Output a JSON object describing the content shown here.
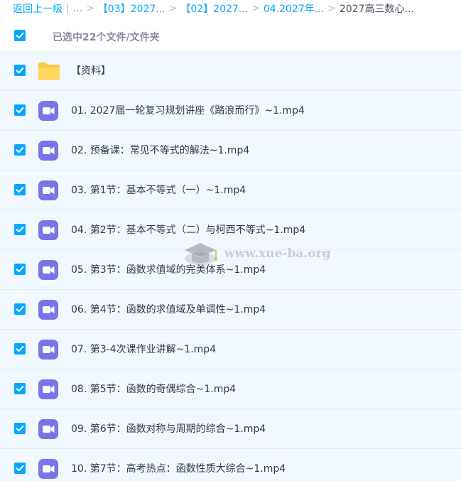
{
  "breadcrumb": {
    "back_label": "返回上一级",
    "divider": "|",
    "ellipsis": "...",
    "items": [
      {
        "label": "【03】2027..."
      },
      {
        "label": "【02】2027..."
      },
      {
        "label": "04.2027年..."
      }
    ],
    "current": "2027高三数心..."
  },
  "selection": {
    "label": "已选中22个文件/文件夹",
    "checked": true
  },
  "files": [
    {
      "name": "【资料】",
      "type": "folder",
      "checked": true
    },
    {
      "name": "01. 2027届一轮复习规划讲座《踏浪而行》~1.mp4",
      "type": "video",
      "checked": true
    },
    {
      "name": "02. 预备课：常见不等式的解法~1.mp4",
      "type": "video",
      "checked": true
    },
    {
      "name": "03. 第1节：基本不等式（一）~1.mp4",
      "type": "video",
      "checked": true
    },
    {
      "name": "04. 第2节：基本不等式（二）与柯西不等式~1.mp4",
      "type": "video",
      "checked": true
    },
    {
      "name": "05. 第3节：函数求值域的完美体系~1.mp4",
      "type": "video",
      "checked": true
    },
    {
      "name": "06. 第4节：函数的求值域及单调性~1.mp4",
      "type": "video",
      "checked": true
    },
    {
      "name": "07. 第3-4次课作业讲解~1.mp4",
      "type": "video",
      "checked": true
    },
    {
      "name": "08. 第5节：函数的奇偶综合~1.mp4",
      "type": "video",
      "checked": true
    },
    {
      "name": "09. 第6节：函数对称与周期的综合~1.mp4",
      "type": "video",
      "checked": true
    },
    {
      "name": "10. 第7节：高考热点：函数性质大综合~1.mp4",
      "type": "video",
      "checked": true
    }
  ],
  "watermark": {
    "text": "www.xue-ba.org"
  },
  "icons": {
    "folder": "folder-icon",
    "video": "video-file-icon",
    "checkbox": "checkbox-checked-icon"
  },
  "colors": {
    "accent": "#06a7ff",
    "row_background": "#f2f8ff",
    "folder": "#ffc93f",
    "video": "#7b74e8"
  }
}
